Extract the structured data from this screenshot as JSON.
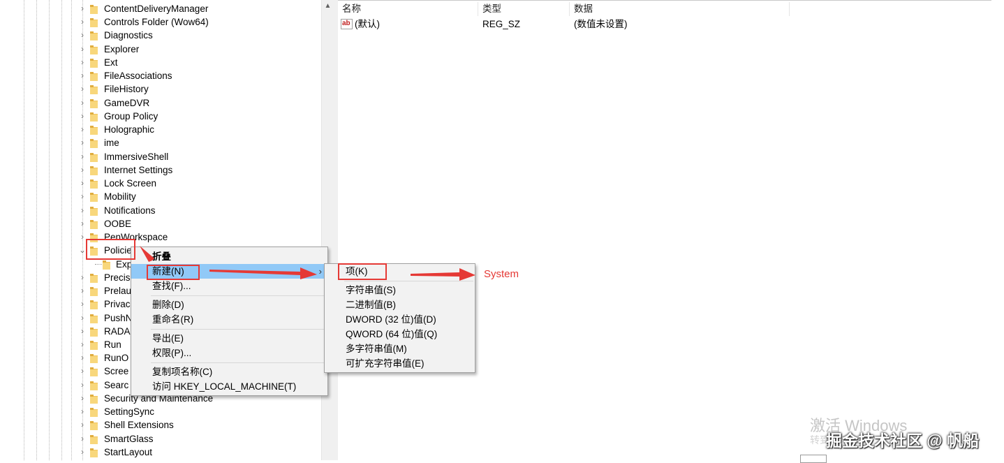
{
  "tree": {
    "items": [
      {
        "label": "ContentDeliveryManager"
      },
      {
        "label": "Controls Folder (Wow64)"
      },
      {
        "label": "Diagnostics"
      },
      {
        "label": "Explorer"
      },
      {
        "label": "Ext"
      },
      {
        "label": "FileAssociations"
      },
      {
        "label": "FileHistory"
      },
      {
        "label": "GameDVR"
      },
      {
        "label": "Group Policy"
      },
      {
        "label": "Holographic"
      },
      {
        "label": "ime"
      },
      {
        "label": "ImmersiveShell"
      },
      {
        "label": "Internet Settings"
      },
      {
        "label": "Lock Screen"
      },
      {
        "label": "Mobility"
      },
      {
        "label": "Notifications"
      },
      {
        "label": "OOBE"
      },
      {
        "label": "PenWorkspace"
      },
      {
        "label": "Policie"
      },
      {
        "label": "Exp"
      },
      {
        "label": "Precis"
      },
      {
        "label": "Prelau"
      },
      {
        "label": "Privac"
      },
      {
        "label": "PushN"
      },
      {
        "label": "RADA"
      },
      {
        "label": "Run"
      },
      {
        "label": "RunO"
      },
      {
        "label": "Scree"
      },
      {
        "label": "Searc"
      },
      {
        "label": "Security and Maintenance"
      },
      {
        "label": "SettingSync"
      },
      {
        "label": "Shell Extensions"
      },
      {
        "label": "SmartGlass"
      },
      {
        "label": "StartLayout"
      }
    ]
  },
  "list": {
    "columns": [
      "名称",
      "类型",
      "数据"
    ],
    "rows": [
      {
        "name": "(默认)",
        "type": "REG_SZ",
        "data": "(数值未设置)",
        "icon": "ab-string-icon"
      }
    ]
  },
  "context_menu": {
    "items": [
      "折叠",
      "新建(N)",
      "查找(F)...",
      "删除(D)",
      "重命名(R)",
      "导出(E)",
      "权限(P)...",
      "复制项名称(C)",
      "访问 HKEY_LOCAL_MACHINE(T)"
    ]
  },
  "submenu": {
    "items": [
      "项(K)",
      "字符串值(S)",
      "二进制值(B)",
      "DWORD (32 位)值(D)",
      "QWORD (64 位)值(Q)",
      "多字符串值(M)",
      "可扩充字符串值(E)"
    ]
  },
  "annotation": {
    "text": "System",
    "color": "#e53935"
  },
  "watermark": {
    "line1": "激活 Windows",
    "line2": "转到",
    "brand": "掘金技术社区 @ 帆船"
  },
  "colors": {
    "highlight": "#91c9f7",
    "folder": "#f2c55c",
    "annotation_red": "#e53935"
  }
}
